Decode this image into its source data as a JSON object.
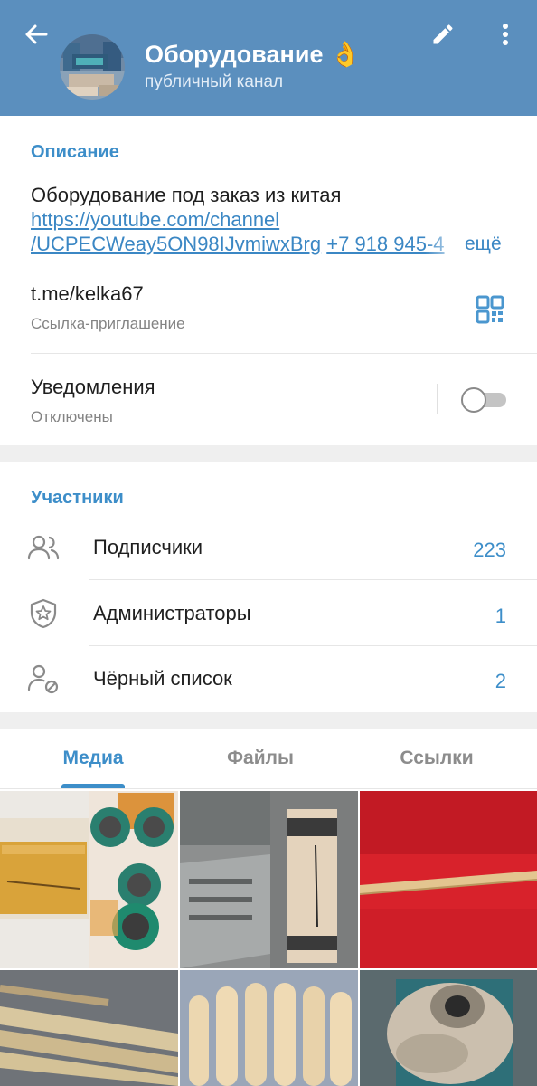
{
  "header": {
    "title": "Оборудование 👌",
    "subtitle": "публичный канал",
    "icons": [
      "arrow-left-icon",
      "pencil-icon",
      "more-vert-icon"
    ]
  },
  "info": {
    "description_title": "Описание",
    "description_text": "Оборудование под заказ из китая",
    "link_line1": "https://youtube.com/channel",
    "link_line2": "/UCPECWeay5ON98IJvmiwxBrg",
    "phone": "+7 918 945-4",
    "more": "ещё",
    "invite_link": "t.me/kelka67",
    "invite_caption": "Ссылка-приглашение",
    "notifications_title": "Уведомления",
    "notifications_status": "Отключены",
    "notifications_enabled": false
  },
  "members": {
    "title": "Участники",
    "items": [
      {
        "label": "Подписчики",
        "count": "223",
        "icon": "people-icon"
      },
      {
        "label": "Администраторы",
        "count": "1",
        "icon": "shield-star-icon"
      },
      {
        "label": "Чёрный список",
        "count": "2",
        "icon": "blocked-user-icon"
      }
    ]
  },
  "tabs": [
    {
      "label": "Медиа",
      "active": true
    },
    {
      "label": "Файлы",
      "active": false
    },
    {
      "label": "Ссылки",
      "active": false
    }
  ],
  "colors": {
    "header_bg": "#5b8fbe",
    "accent": "#3d8ec9",
    "link": "#3b87c4"
  }
}
